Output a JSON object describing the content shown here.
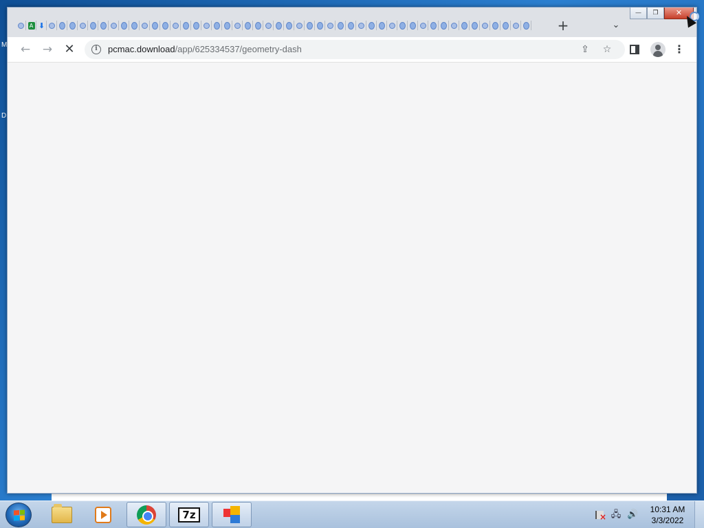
{
  "desktop": {
    "edge_letter_1": "M",
    "edge_letter_2": "D"
  },
  "window": {
    "caption_minimize": "—",
    "caption_maximize": "❐",
    "caption_close": "✕"
  },
  "tabstrip": {
    "new_tab_label": "+",
    "tab_search_label": "⌄",
    "tab_count": 50
  },
  "toolbar": {
    "back_label": "←",
    "forward_label": "→",
    "stop_label": "✕",
    "url_host": "pcmac.download",
    "url_path": "/app/625334537/geometry-dash",
    "share_label": "⇪",
    "bookmark_label": "☆",
    "menu_label": "⋮"
  },
  "taskbar": {
    "clock_time": "10:31 AM",
    "clock_date": "3/3/2022",
    "sevenz_label": "7z",
    "volume_label": "🔊",
    "network_label": "🖧"
  },
  "colors": {
    "tabstrip_bg": "#dee1e6",
    "content_bg": "#f5f5f6",
    "taskbar_bg": "#b7cce4",
    "close_button": "#c7402a"
  },
  "icons": [
    "chrome-icon",
    "folder-icon",
    "media-player-icon",
    "sevenzip-icon",
    "tiles-app-icon",
    "windows-start-icon",
    "info-icon",
    "star-icon",
    "share-icon",
    "side-panel-icon",
    "profile-icon",
    "kebab-menu-icon",
    "network-icon",
    "volume-icon",
    "action-center-flag-icon"
  ]
}
